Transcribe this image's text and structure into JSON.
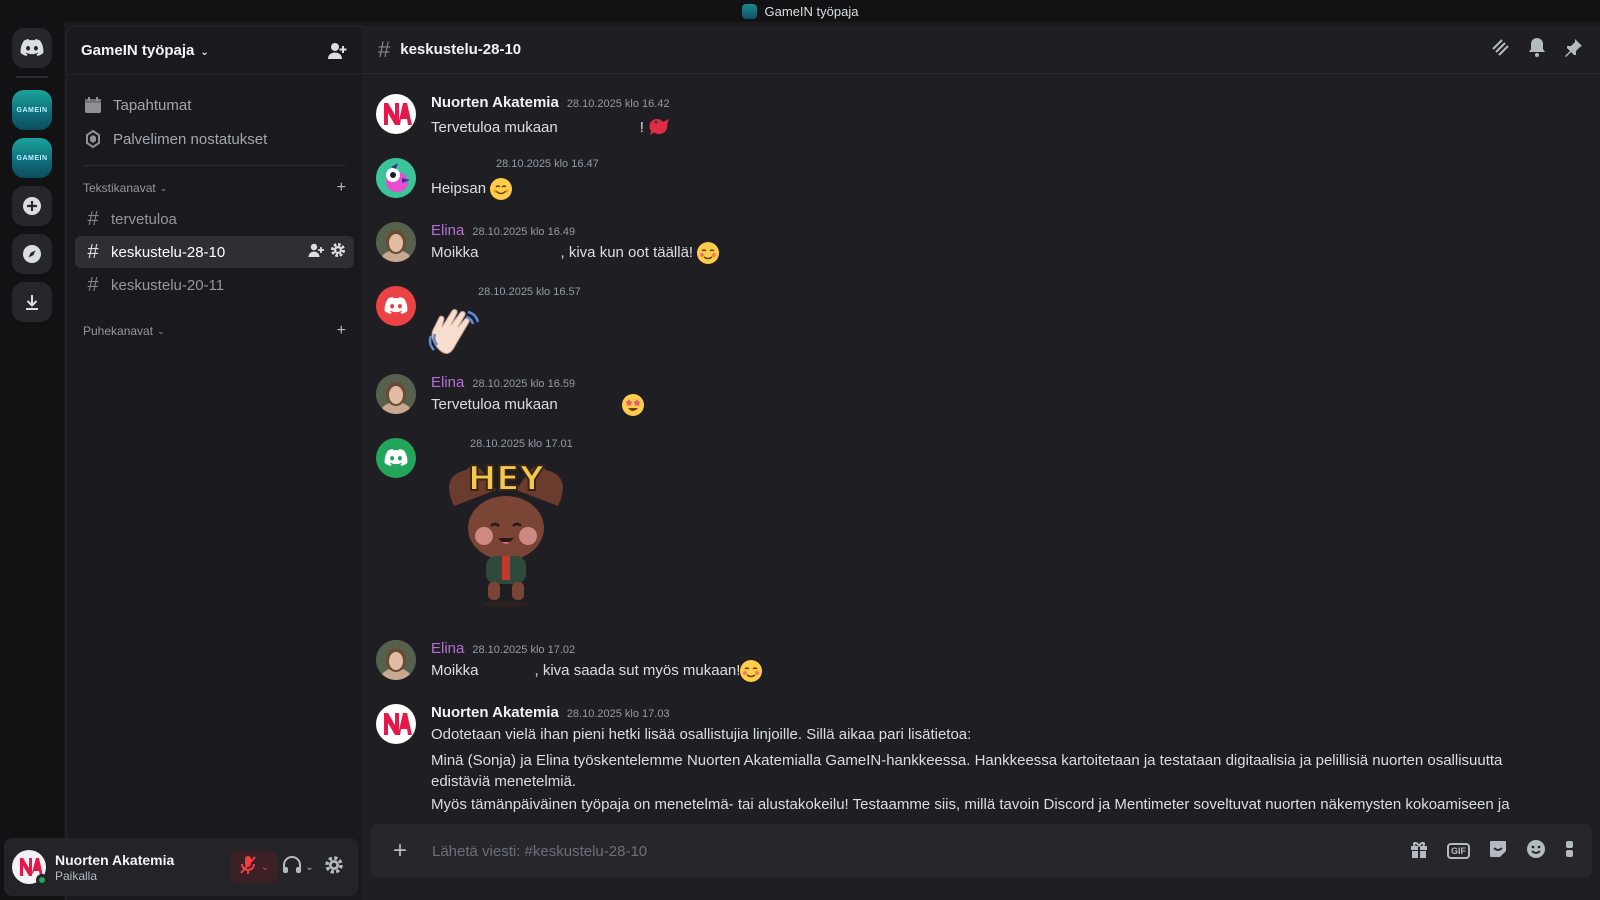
{
  "window": {
    "title": "GameIN työpaja"
  },
  "guild": {
    "name": "GameIN työpaja",
    "server_icon_text": "GAMEIN"
  },
  "sidebar": {
    "top_items": [
      {
        "label": "Tapahtumat",
        "icon": "calendar-icon"
      },
      {
        "label": "Palvelimen nostatukset",
        "icon": "boost-icon"
      }
    ],
    "text_category": "Tekstikanavat",
    "voice_category": "Puhekanavat",
    "channels": [
      {
        "name": "tervetuloa",
        "active": false
      },
      {
        "name": "keskustelu-28-10",
        "active": true
      },
      {
        "name": "keskustelu-20-11",
        "active": false
      }
    ]
  },
  "header": {
    "channel": "keskustelu-28-10"
  },
  "user": {
    "name": "Nuorten Akatemia",
    "status": "Paikalla",
    "status_color": "#23a55a"
  },
  "messages": [
    {
      "author": "Nuorten Akatemia",
      "time": "28.10.2025 klo 16.42",
      "text_a": "Tervetuloa mukaan",
      "text_b": "!"
    },
    {
      "author": "",
      "time": "28.10.2025 klo 16.47",
      "text_a": "Heipsan"
    },
    {
      "author": "Elina",
      "time": "28.10.2025 klo 16.49",
      "text_a": "Moikka",
      "text_b": ", kiva kun oot täällä!"
    },
    {
      "author": "",
      "time": "28.10.2025 klo 16.57",
      "sticker": "waving-hand"
    },
    {
      "author": "Elina",
      "time": "28.10.2025 klo 16.59",
      "text_a": "Tervetuloa mukaan"
    },
    {
      "author": "",
      "time": "28.10.2025 klo 17.01",
      "sticker": "hey-bear",
      "sticker_text": "HEY"
    },
    {
      "author": "Elina",
      "time": "28.10.2025 klo 17.02",
      "text_a": "Moikka",
      "text_b": ", kiva saada sut myös mukaan!"
    },
    {
      "author": "Nuorten Akatemia",
      "time": "28.10.2025 klo 17.03",
      "line1": "Odotetaan vielä ihan pieni hetki lisää osallistujia linjoille. Sillä aikaa pari lisätietoa:",
      "line2": "Minä (Sonja) ja Elina työskentelemme Nuorten Akatemialla GameIN-hankkeessa. Hankkeessa kartoitetaan ja testataan digitaalisia ja pelillisiä nuorten osallisuutta edistäviä menetelmiä.",
      "line3": "Myös tämänpäiväinen työpaja on menetelmä- tai alustakokeilu! Testaamme siis, millä tavoin Discord ja Mentimeter soveltuvat nuorten näkemysten kokoamiseen ja"
    }
  ],
  "composer": {
    "placeholder": "Lähetä viesti: #keskustelu-28-10",
    "gif_label": "GIF"
  },
  "colors": {
    "accent": "#5865f2",
    "elina": "#b36fd1",
    "active_channel_bg": "#2e2e34"
  }
}
